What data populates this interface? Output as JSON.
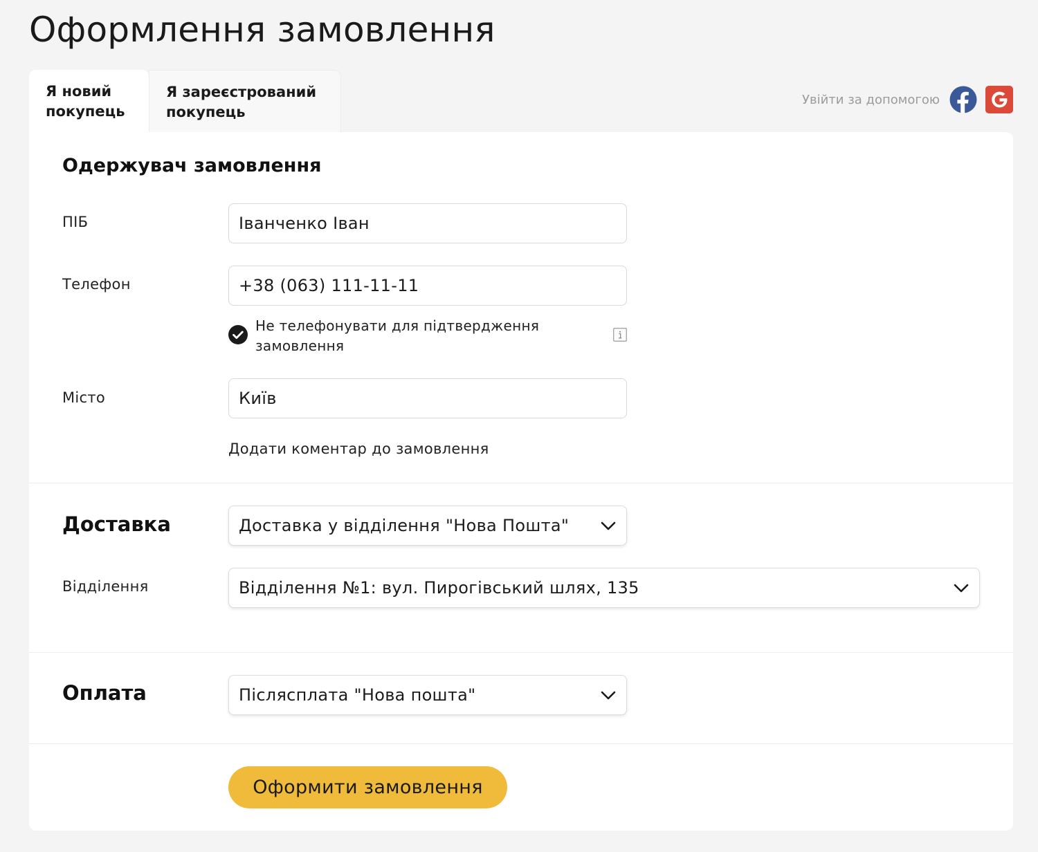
{
  "page": {
    "title": "Оформлення замовлення"
  },
  "tabs": [
    {
      "line1": "Я новий",
      "line2": "покупець",
      "active": true
    },
    {
      "line1": "Я зареєстрований",
      "line2": "покупець",
      "active": false
    }
  ],
  "social": {
    "label": "Увійти за допомогою",
    "providers": [
      "facebook-icon",
      "google-icon"
    ],
    "facebook_color": "#3b5998",
    "google_color": "#db4a39"
  },
  "recipient": {
    "title": "Одержувач замовлення",
    "name": {
      "label": "ПІБ",
      "value": "Іванченко Іван"
    },
    "phone": {
      "label": "Телефон",
      "value": "+38 (063) 111-11-11"
    },
    "no_call": {
      "label": "Не телефонувати для підтвердження замовлення",
      "checked": true
    },
    "city": {
      "label": "Місто",
      "value": "Київ"
    },
    "comment_link": "Додати коментар до замовлення"
  },
  "delivery": {
    "title": "Доставка",
    "method": "Доставка у відділення \"Нова Пошта\"",
    "branch": {
      "label": "Відділення",
      "value": "Відділення №1: вул. Пирогівський шлях, 135"
    }
  },
  "payment": {
    "title": "Оплата",
    "method": "Післясплата \"Нова пошта\""
  },
  "submit": {
    "label": "Оформити замовлення",
    "color": "#f0bb3b"
  }
}
